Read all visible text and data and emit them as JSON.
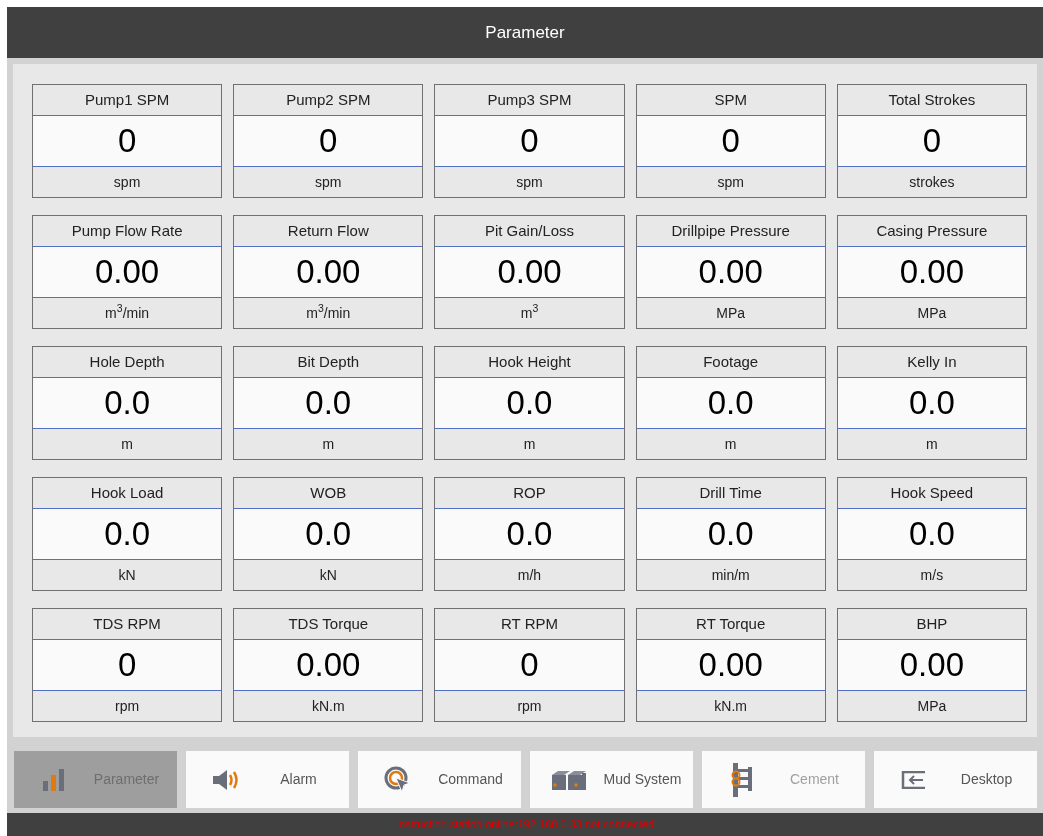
{
  "window": {
    "title": "Parameter"
  },
  "parameters": [
    {
      "label": "Pump1 SPM",
      "value": "0",
      "unit": "spm"
    },
    {
      "label": "Pump2 SPM",
      "value": "0",
      "unit": "spm"
    },
    {
      "label": "Pump3 SPM",
      "value": "0",
      "unit": "spm"
    },
    {
      "label": "SPM",
      "value": "0",
      "unit": "spm"
    },
    {
      "label": "Total Strokes",
      "value": "0",
      "unit": "strokes"
    },
    {
      "label": "Pump Flow Rate",
      "value": "0.00",
      "unit": "m$^{3}$/min"
    },
    {
      "label": "Return Flow",
      "value": "0.00",
      "unit": "m$^{3}$/min"
    },
    {
      "label": "Pit Gain/Loss",
      "value": "0.00",
      "unit": "m$^{3}$"
    },
    {
      "label": "Drillpipe Pressure",
      "value": "0.00",
      "unit": "MPa"
    },
    {
      "label": "Casing Pressure",
      "value": "0.00",
      "unit": "MPa"
    },
    {
      "label": "Hole Depth",
      "value": "0.0",
      "unit": "m"
    },
    {
      "label": "Bit Depth",
      "value": "0.0",
      "unit": "m"
    },
    {
      "label": "Hook Height",
      "value": "0.0",
      "unit": "m"
    },
    {
      "label": "Footage",
      "value": "0.0",
      "unit": "m"
    },
    {
      "label": "Kelly In",
      "value": "0.0",
      "unit": "m"
    },
    {
      "label": "Hook Load",
      "value": "0.0",
      "unit": "kN"
    },
    {
      "label": "WOB",
      "value": "0.0",
      "unit": "kN"
    },
    {
      "label": "ROP",
      "value": "0.0",
      "unit": "m/h"
    },
    {
      "label": "Drill Time",
      "value": "0.0",
      "unit": "min/m"
    },
    {
      "label": "Hook Speed",
      "value": "0.0",
      "unit": "m/s"
    },
    {
      "label": "TDS RPM",
      "value": "0",
      "unit": "rpm"
    },
    {
      "label": "TDS Torque",
      "value": "0.00",
      "unit": "kN.m"
    },
    {
      "label": "RT RPM",
      "value": "0",
      "unit": "rpm"
    },
    {
      "label": "RT Torque",
      "value": "0.00",
      "unit": "kN.m"
    },
    {
      "label": "BHP",
      "value": "0.00",
      "unit": "MPa"
    }
  ],
  "nav": [
    {
      "label": "Parameter",
      "selected": true,
      "disabled": false
    },
    {
      "label": "Alarm",
      "selected": false,
      "disabled": false
    },
    {
      "label": "Command",
      "selected": false,
      "disabled": false
    },
    {
      "label": "Mud System",
      "selected": false,
      "disabled": false
    },
    {
      "label": "Cement",
      "selected": false,
      "disabled": true
    },
    {
      "label": "Desktop",
      "selected": false,
      "disabled": false
    }
  ],
  "status_bar": "Instruction station online:192.168.0.33 not connected"
}
